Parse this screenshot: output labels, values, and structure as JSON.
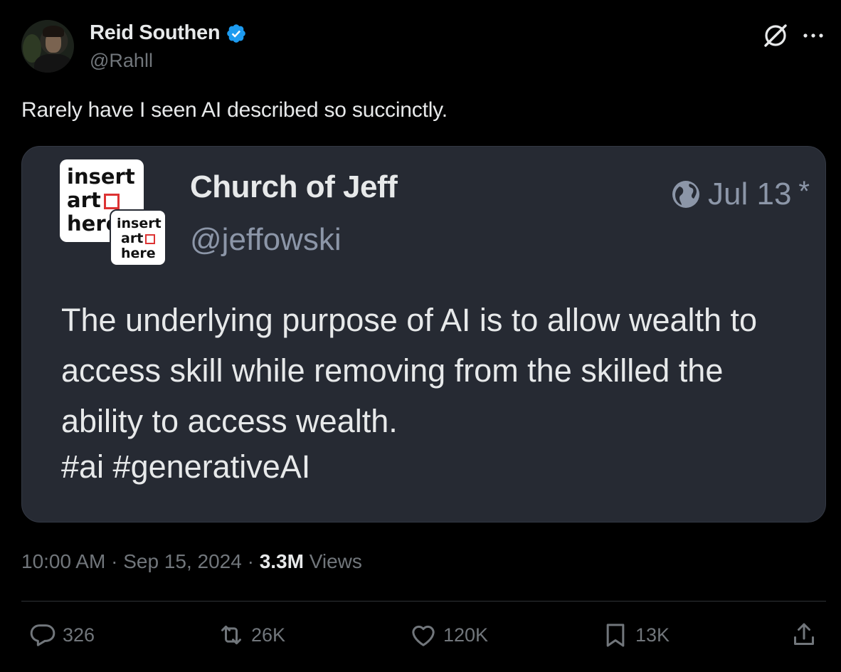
{
  "author": {
    "display_name": "Reid Southen",
    "handle": "@Rahll",
    "verified": true
  },
  "tweet": {
    "text": "Rarely have I seen AI described so succinctly."
  },
  "quoted_post": {
    "display_name": "Church of Jeff",
    "handle": "@jeffowski",
    "date": "Jul 13",
    "edited_marker": "*",
    "logo_text_large": [
      "insert",
      "art",
      "here"
    ],
    "logo_text_small": [
      "insert",
      "art",
      "here"
    ],
    "body": "The underlying purpose of AI is to allow wealth to access skill while removing from the skilled the ability to access wealth.",
    "hashtags": "#ai #generativeAI"
  },
  "meta": {
    "time": "10:00 AM",
    "separator": " · ",
    "date": "Sep 15, 2024",
    "views_count": "3.3M",
    "views_label": " Views"
  },
  "actions": {
    "replies": "326",
    "reposts": "26K",
    "likes": "120K",
    "bookmarks": "13K"
  },
  "colors": {
    "background": "#000000",
    "text_primary": "#e7e9ea",
    "text_secondary": "#71767b",
    "verified": "#1d9bf0",
    "quote_card": "#262a33"
  }
}
